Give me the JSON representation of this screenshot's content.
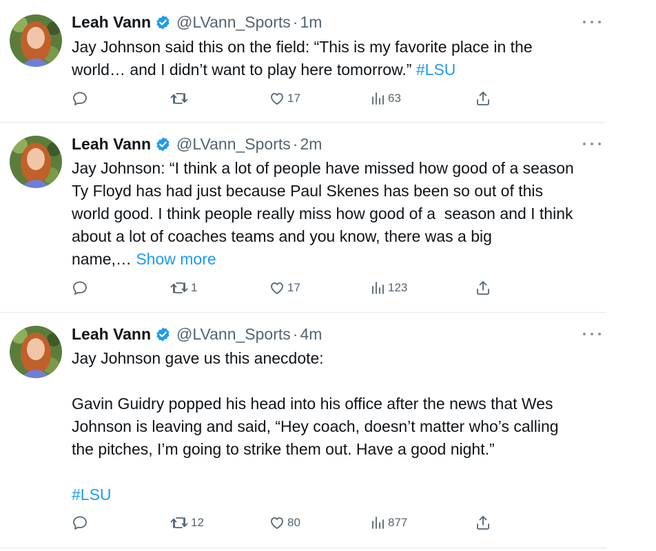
{
  "tweets": [
    {
      "author": {
        "name": "Leah Vann",
        "handle": "@LVann_Sports",
        "verified": true
      },
      "time": "1m",
      "separator": "·",
      "text_lines": [
        "Jay Johnson said this on the field: “This is my favorite place in the",
        "world… and I didn’t want to play here tomorrow.”"
      ],
      "hashtag": "#LSU",
      "stats": {
        "replies": "",
        "retweets": "",
        "likes": "17",
        "views": "63"
      }
    },
    {
      "author": {
        "name": "Leah Vann",
        "handle": "@LVann_Sports",
        "verified": true
      },
      "time": "2m",
      "separator": "·",
      "text_lines": [
        "Jay Johnson: “I think a lot of people have missed how good of a season",
        "Ty Floyd has had just because Paul Skenes has been so out of this",
        "world good. I think people really miss how good of a  season and I think",
        "about a lot of coaches teams and you know, there was a big",
        "name,…"
      ],
      "show_more": "Show more",
      "stats": {
        "replies": "",
        "retweets": "1",
        "likes": "17",
        "views": "123"
      }
    },
    {
      "author": {
        "name": "Leah Vann",
        "handle": "@LVann_Sports",
        "verified": true
      },
      "time": "4m",
      "separator": "·",
      "paragraph_1": "Jay Johnson gave us this anecdote:",
      "paragraph_2_lines": [
        "Gavin Guidry popped his head into his office after the news that Wes",
        "Johnson is leaving and said, “Hey coach, doesn’t matter who’s calling",
        "the pitches, I’m going to strike them out. Have a good night.”"
      ],
      "hashtag": "#LSU",
      "stats": {
        "replies": "",
        "retweets": "12",
        "likes": "80",
        "views": "877"
      }
    }
  ],
  "icons": {
    "reply": "speech-bubble-icon",
    "retweet": "retweet-arrows-icon",
    "like": "heart-icon",
    "views": "bar-chart-icon",
    "share": "share-upload-icon",
    "more": "more-dots-icon",
    "verified": "verified-badge-icon"
  },
  "colors": {
    "link": "#1d9bf0",
    "verified": "#1d9bf0",
    "secondary_text": "#536471",
    "primary_text": "#0f1419",
    "divider": "#e1e8ed"
  }
}
